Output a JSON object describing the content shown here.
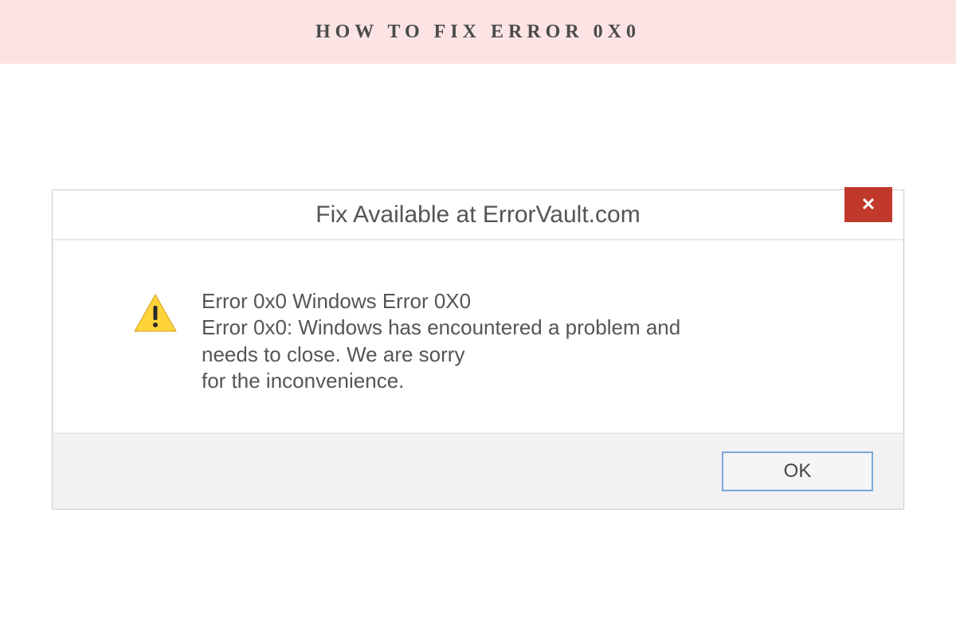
{
  "banner": {
    "title": "HOW TO FIX ERROR 0X0"
  },
  "dialog": {
    "title": "Fix Available at ErrorVault.com",
    "close_label": "✕",
    "message_line1": "Error 0x0 Windows Error 0X0",
    "message_line2": "Error 0x0: Windows has encountered a problem and",
    "message_line3": "needs to close. We are sorry",
    "message_line4": "for the inconvenience.",
    "ok_label": "OK"
  },
  "colors": {
    "banner_bg": "#fce4e4",
    "close_bg": "#c0392b",
    "ok_border": "#7aa8d8"
  }
}
